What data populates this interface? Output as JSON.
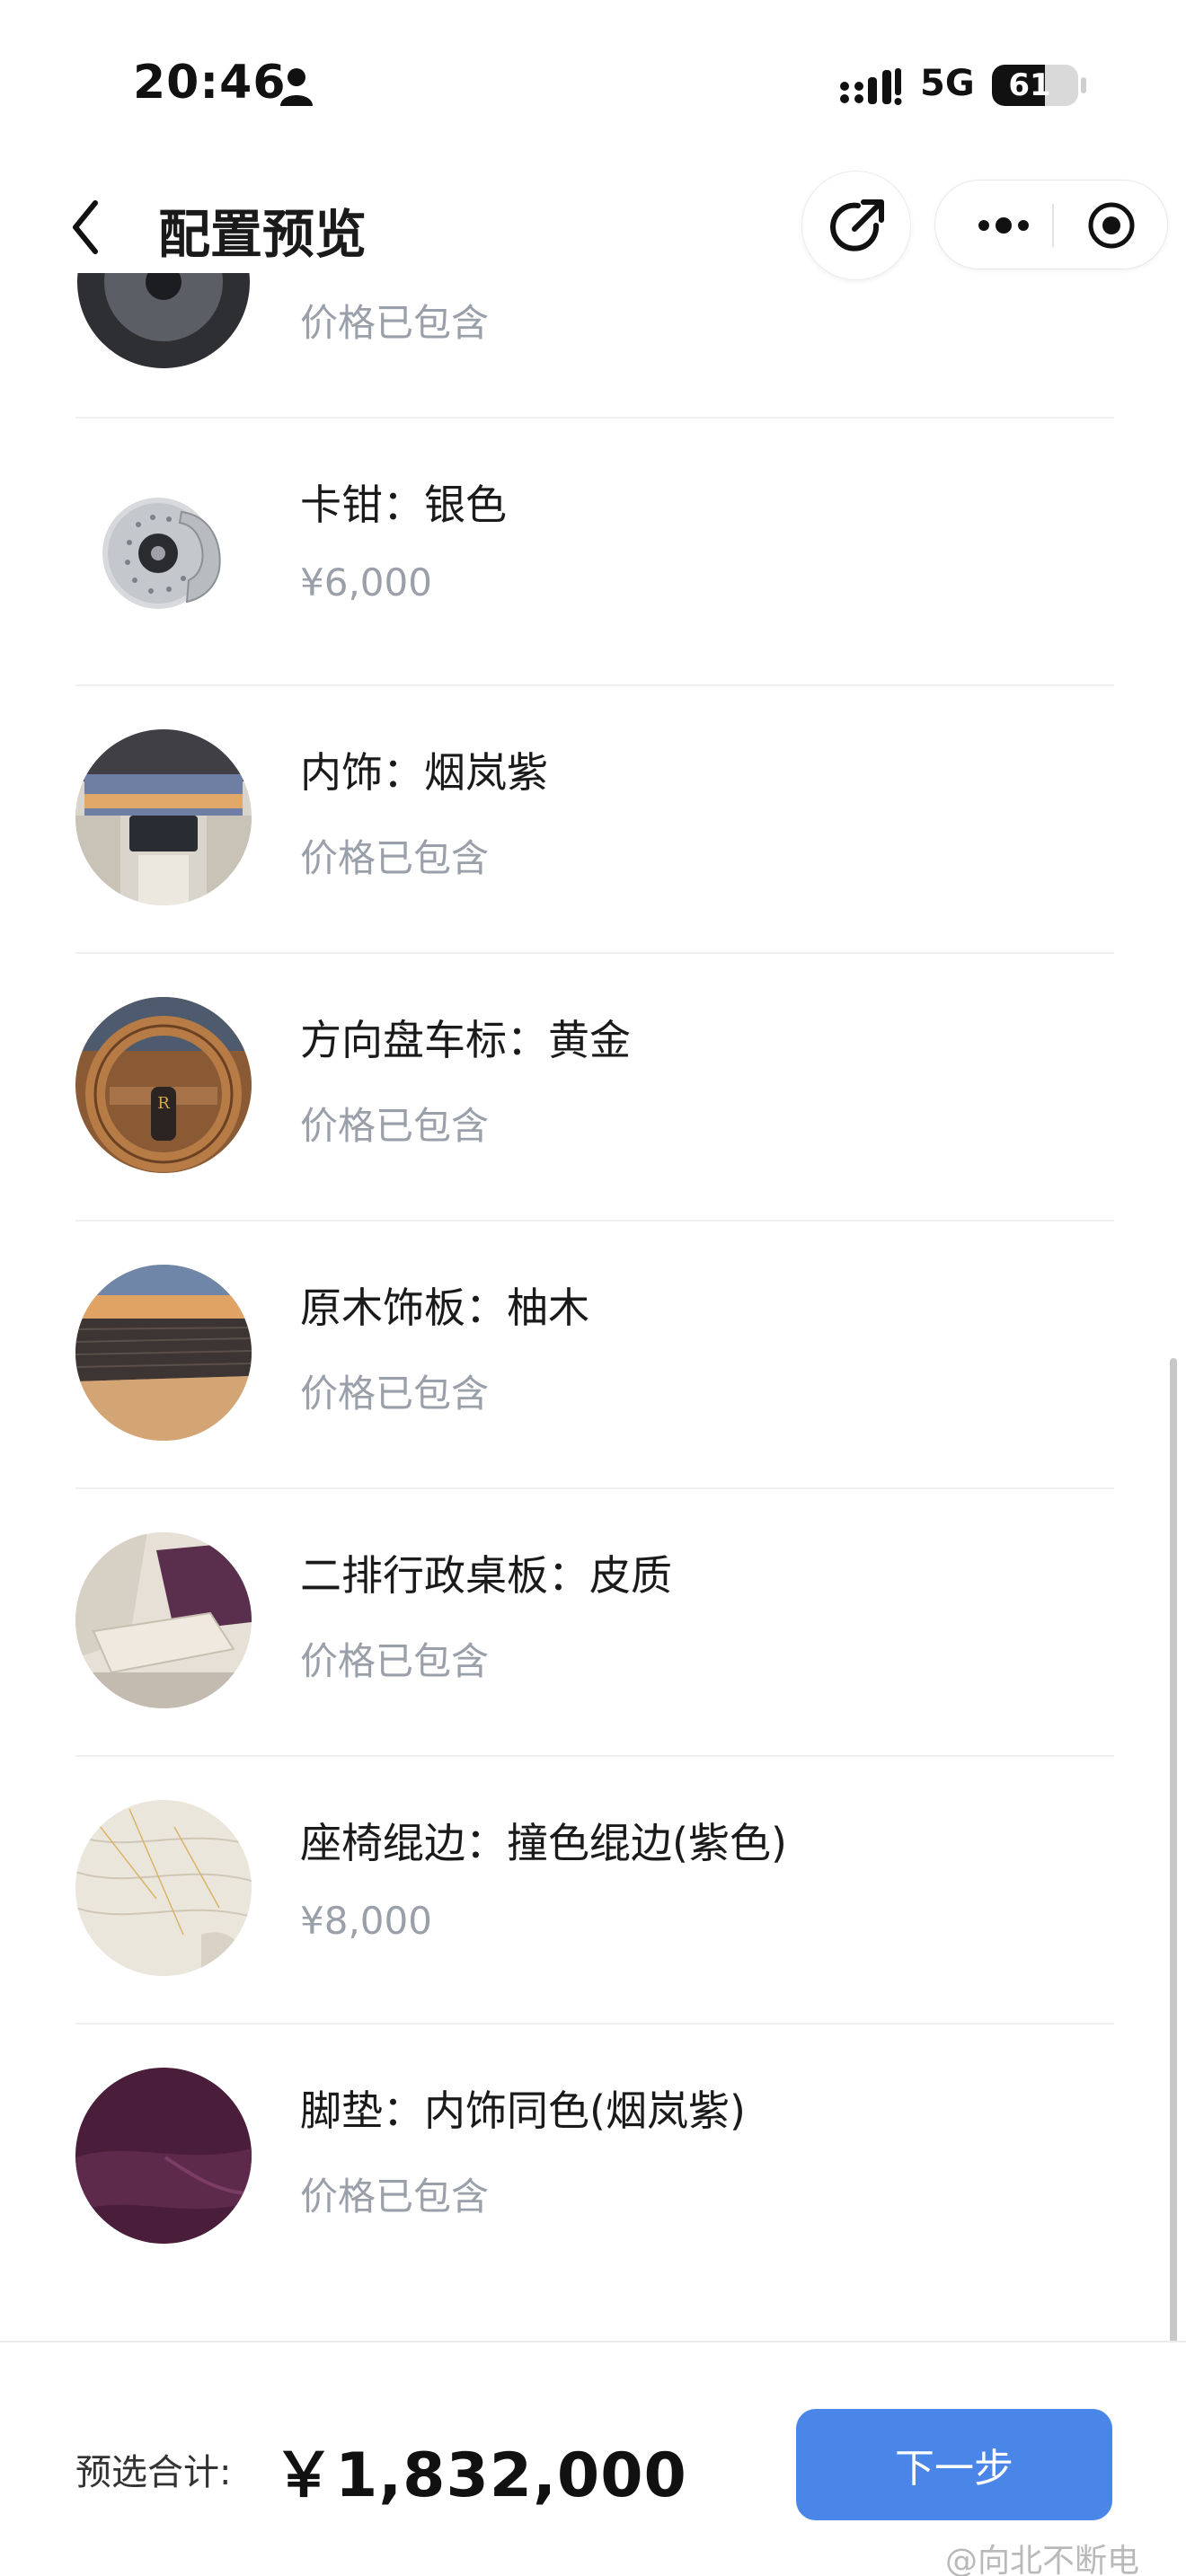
{
  "status_bar": {
    "time": "20:46",
    "network": "5G",
    "battery": "61",
    "battery_level": 0.61
  },
  "nav": {
    "title": "配置预览"
  },
  "items": [
    {
      "title": "",
      "price": "价格已包含",
      "icon": "wheel-thumb"
    },
    {
      "title": "卡钳：银色",
      "price": "¥6,000",
      "icon": "brake-caliper-thumb"
    },
    {
      "title": "内饰：烟岚紫",
      "price": "价格已包含",
      "icon": "interior-thumb"
    },
    {
      "title": "方向盘车标：黄金",
      "price": "价格已包含",
      "icon": "steering-wheel-thumb"
    },
    {
      "title": "原木饰板：柚木",
      "price": "价格已包含",
      "icon": "wood-trim-thumb"
    },
    {
      "title": "二排行政桌板：皮质",
      "price": "价格已包含",
      "icon": "table-thumb"
    },
    {
      "title": "座椅绲边：撞色绲边(紫色)",
      "price": "¥8,000",
      "icon": "seat-piping-thumb"
    },
    {
      "title": "脚垫：内饰同色(烟岚紫)",
      "price": "价格已包含",
      "icon": "floor-mat-thumb"
    }
  ],
  "footer": {
    "total_label": "预选合计:",
    "total_value": "￥1,832,000",
    "next_label": "下一步"
  },
  "watermark": "@向北不断电",
  "colors": {
    "accent": "#4a86e8",
    "muted_text": "#9aa0a9",
    "floor_mat": "#4a1d3a"
  }
}
